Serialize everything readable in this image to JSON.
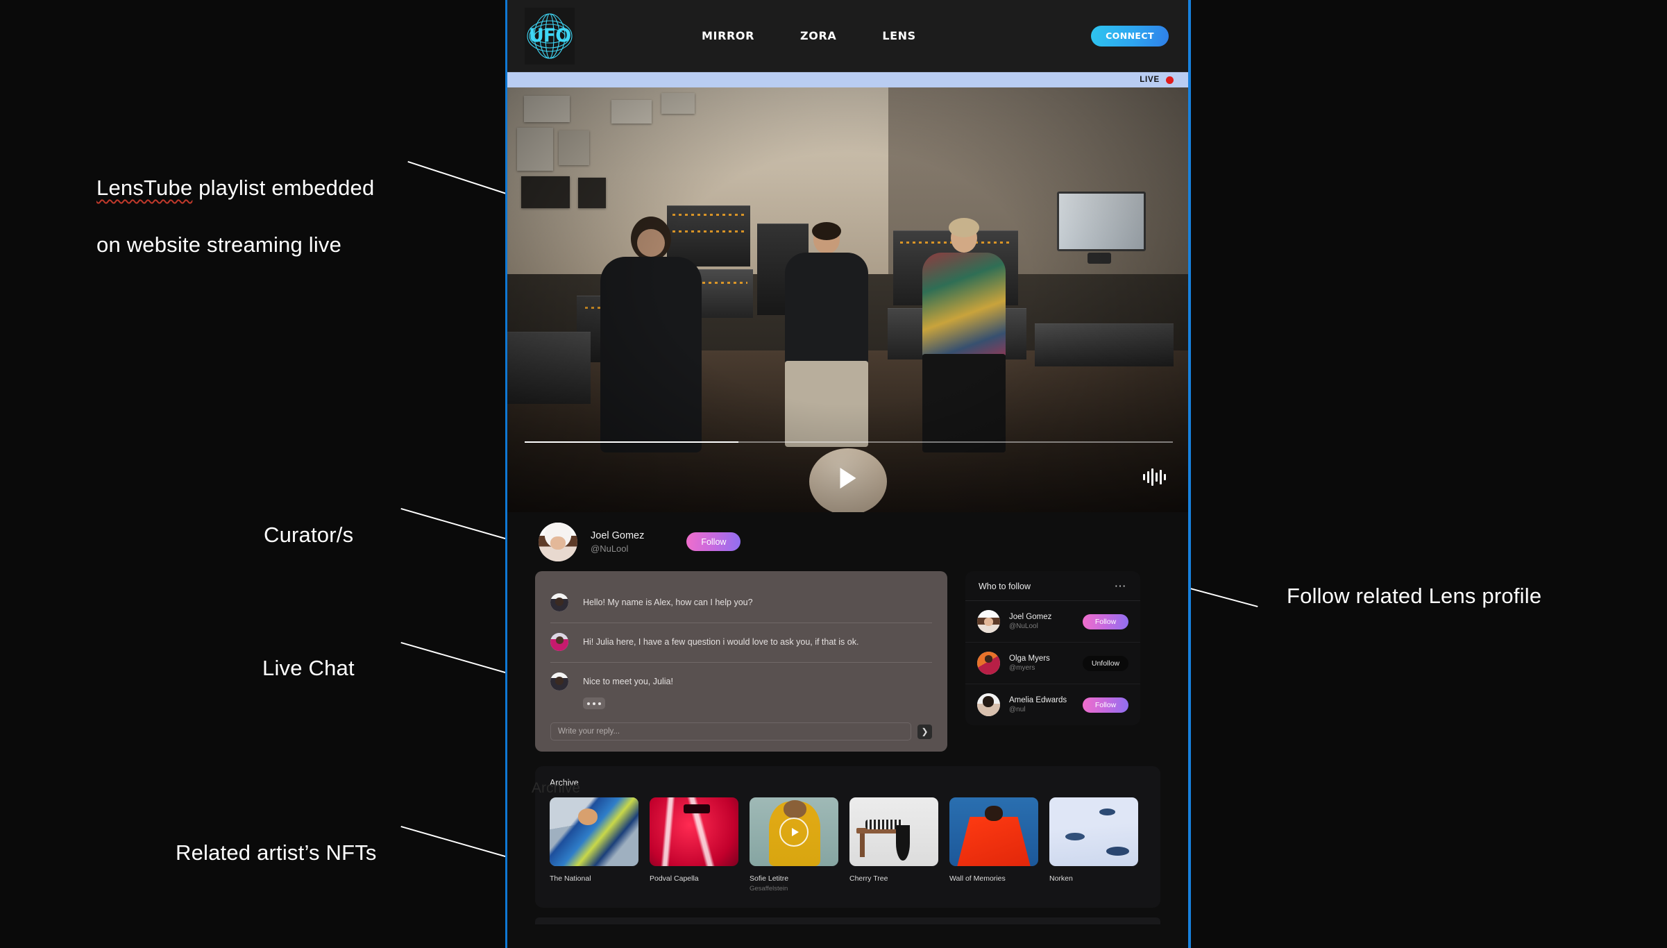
{
  "annotations": [
    {
      "id": "a1",
      "line1_pre": "LensTube",
      "line1_post": " playlist embedded",
      "line2": "on website streaming live"
    },
    {
      "id": "a2",
      "text": "Curator/s"
    },
    {
      "id": "a3",
      "text": "Live Chat"
    },
    {
      "id": "a4",
      "text": "Related artist’s NFTs"
    },
    {
      "id": "a5",
      "text": "Follow related Lens profile"
    }
  ],
  "header": {
    "logo_text": "UFO",
    "nav": [
      {
        "label": "MIRROR"
      },
      {
        "label": "ZORA"
      },
      {
        "label": "LENS"
      }
    ],
    "connect_label": "CONNECT"
  },
  "video": {
    "live_label": "LIVE",
    "progress_percent": 33
  },
  "curator": {
    "name": "Joel Gomez",
    "handle": "@NuLool",
    "follow_label": "Follow"
  },
  "chat": {
    "messages": [
      {
        "text": "Hello! My name is Alex, how can I help you?"
      },
      {
        "text": "Hi! Julia here, I have a few question i would love to ask you, if that is ok."
      },
      {
        "text": "Nice to meet you, Julia!"
      }
    ],
    "input_placeholder": "Write your reply...",
    "input_value": "",
    "send_icon": "chevron-right-icon"
  },
  "who_to_follow": {
    "title": "Who to follow",
    "menu_icon": "more-horizontal-icon",
    "rows": [
      {
        "name": "Joel Gomez",
        "handle": "@NuLool",
        "action": "Follow",
        "state": "not-following"
      },
      {
        "name": "Olga Myers",
        "handle": "@myers",
        "action": "Unfollow",
        "state": "following"
      },
      {
        "name": "Amelia Edwards",
        "handle": "@nul",
        "action": "Follow",
        "state": "not-following"
      }
    ]
  },
  "archive": {
    "title": "Archive",
    "ghost_title": "Archive",
    "items": [
      {
        "title": "The National",
        "subtitle": ""
      },
      {
        "title": "Podval Capella",
        "subtitle": ""
      },
      {
        "title": "Sofie Letitre",
        "subtitle": "Gesaffelstein"
      },
      {
        "title": "Cherry Tree",
        "subtitle": ""
      },
      {
        "title": "Wall of Memories",
        "subtitle": ""
      },
      {
        "title": "Norken",
        "subtitle": ""
      }
    ]
  },
  "colors": {
    "accent_cyan": "#3fd6f5",
    "frame_border": "#1781dd",
    "follow_gradient_start": "#f06ecb",
    "follow_gradient_end": "#8f6ff0",
    "live_dot": "#e01b1b",
    "live_bar": "#b9cdf2",
    "chat_panel": "#595150",
    "page_background": "#0a0a0a"
  }
}
